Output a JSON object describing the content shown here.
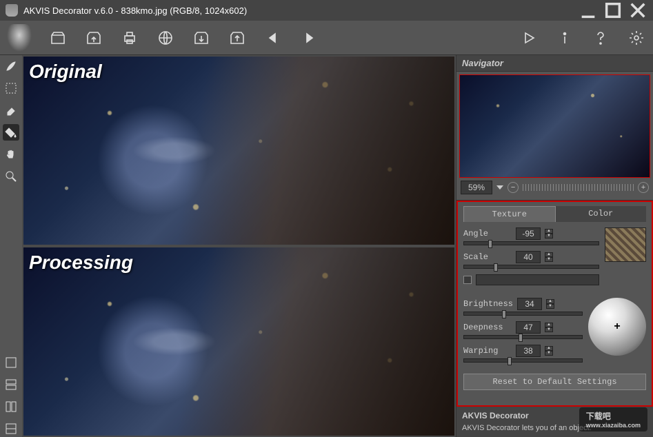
{
  "title": "AKVIS Decorator v.6.0 - 838kmo.jpg (RGB/8, 1024x602)",
  "canvas": {
    "original_label": "Original",
    "processing_label": "Processing"
  },
  "navigator": {
    "title": "Navigator",
    "zoom": "59%"
  },
  "tabs": {
    "texture": "Texture",
    "color": "Color"
  },
  "params": {
    "angle": {
      "label": "Angle",
      "value": "-95",
      "pct": 18
    },
    "scale": {
      "label": "Scale",
      "value": "40",
      "pct": 22
    },
    "brightness": {
      "label": "Brightness",
      "value": "34",
      "pct": 32
    },
    "deepness": {
      "label": "Deepness",
      "value": "47",
      "pct": 46
    },
    "warping": {
      "label": "Warping",
      "value": "38",
      "pct": 37
    },
    "reset": "Reset to Default Settings"
  },
  "help": {
    "title": "AKVIS Decorator",
    "text": "AKVIS Decorator lets you of an object."
  },
  "watermark": {
    "main": "下载吧",
    "sub": "www.xiazaiba.com"
  }
}
